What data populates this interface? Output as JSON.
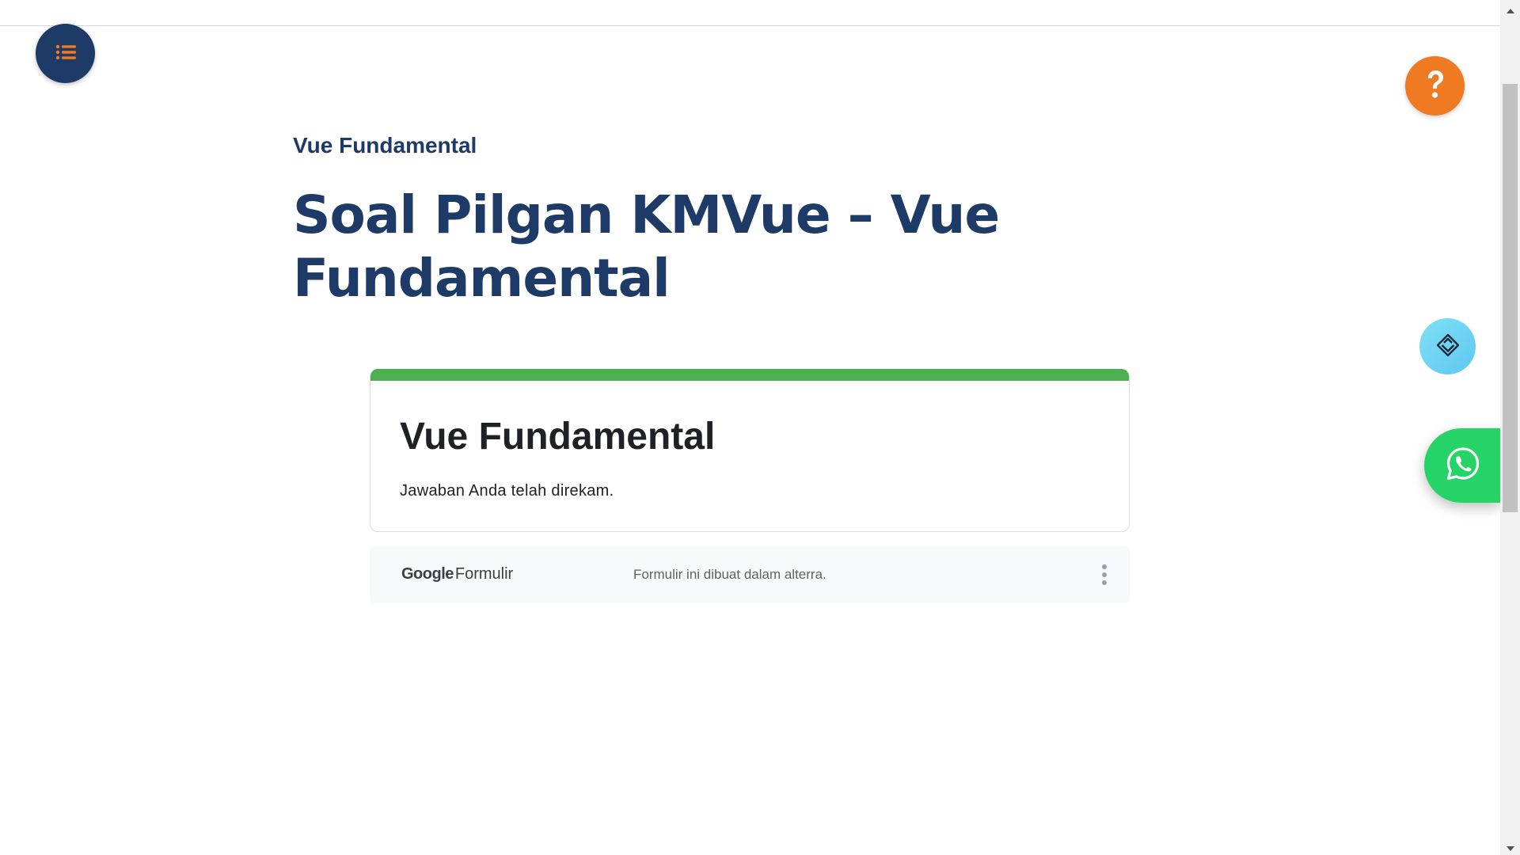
{
  "header": {
    "menu_icon": "list-icon",
    "help_icon": "question-mark-icon",
    "scan_icon": "diamond-layers-icon",
    "whatsapp_icon": "whatsapp-icon"
  },
  "breadcrumb": "Vue Fundamental",
  "page_title": "Soal Pilgan KMVue – Vue Fundamental",
  "form": {
    "title": "Vue Fundamental",
    "message": "Jawaban Anda telah direkam.",
    "accent_color": "#4caf50"
  },
  "footer": {
    "logo_google": "Google",
    "logo_formulir": "Formulir",
    "note": "Formulir ini dibuat dalam alterra.",
    "more_icon": "vertical-dots-icon"
  },
  "colors": {
    "navy": "#1e3a66",
    "orange": "#f07a22",
    "whatsapp_green": "#25d366",
    "cyan": "#5ec8f2"
  }
}
